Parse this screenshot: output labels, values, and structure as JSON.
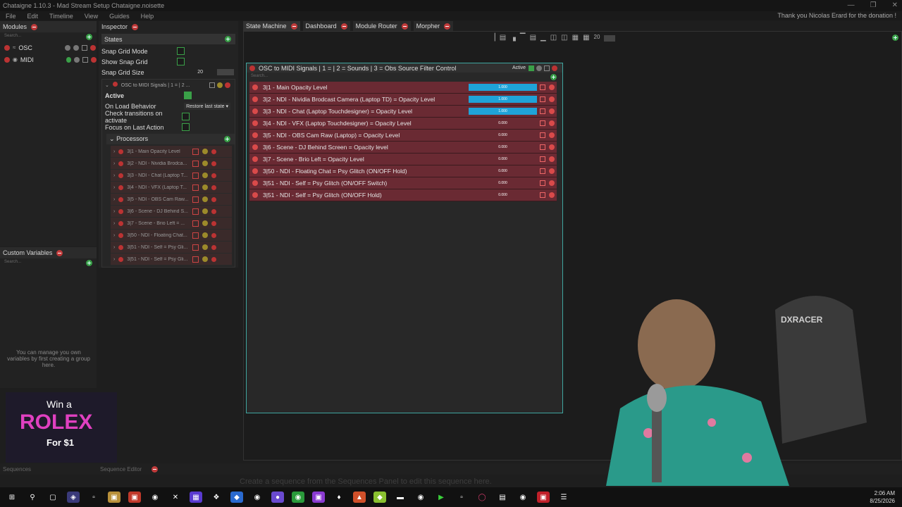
{
  "window": {
    "title": "Chataigne 1.10.3 - Mad Stream Setup Chataigne.noisette",
    "thanks": "Thank you Nicolas Erard for the donation !"
  },
  "menu": [
    "File",
    "Edit",
    "Timeline",
    "View",
    "Guides",
    "Help"
  ],
  "modules": {
    "title": "Modules",
    "search": "Search...",
    "items": [
      {
        "label": "OSC"
      },
      {
        "label": "MIDI"
      }
    ]
  },
  "custom_variables": {
    "title": "Custom Variables",
    "search": "Search...",
    "hint": "You can manage you own variables by first creating a group here."
  },
  "inspector": {
    "title": "Inspector",
    "section": "States",
    "snap_grid_mode": "Snap Grid Mode",
    "show_snap_grid": "Show Snap Grid",
    "snap_grid_size_label": "Snap Grid Size",
    "snap_grid_size": "20",
    "state_name": "OSC to MIDI Signals | 1 = | 2 ...",
    "active_label": "Active",
    "on_load_label": "On Load Behavior",
    "on_load_value": "Restore last state",
    "check_transitions": "Check transitions on activate",
    "focus_last": "Focus on Last Action",
    "processors_label": "Processors",
    "processors": [
      "3|1 - Main Opacity Level",
      "3|2 - NDI - Nividia Brodca...",
      "3|3 - NDI - Chat (Laptop T...",
      "3|4 - NDI - VFX (Laptop T...",
      "3|5 - NDI - OBS Cam Raw...",
      "3|6 - Scene - DJ Behind S...",
      "3|7 - Scene - Brio Left = ...",
      "3|50 - NDI - Floating Chat...",
      "3|51 - NDI - Self = Psy Gli...",
      "3|51 - NDI - Self = Psy Gli..."
    ]
  },
  "tabs": [
    {
      "label": "State Machine"
    },
    {
      "label": "Dashboard"
    },
    {
      "label": "Module Router"
    },
    {
      "label": "Morpher"
    }
  ],
  "toolbar": {
    "grid_size": "20"
  },
  "state": {
    "title": "OSC to MIDI Signals | 1 =  | 2 = Sounds | 3 = Obs Source Filter Control",
    "active": "Active",
    "search": "Search...",
    "actions": [
      {
        "label": "3|1 - Main Opacity Level",
        "value": "1.000",
        "fill": 1
      },
      {
        "label": "3|2 - NDI - Nividia Brodcast Camera (Laptop TD) = Opacity Level",
        "value": "1.000",
        "fill": 1
      },
      {
        "label": "3|3 - NDI - Chat (Laptop Touchdesigner) = Opacity Level",
        "value": "1.000",
        "fill": 1
      },
      {
        "label": "3|4 - NDI - VFX (Laptop Touchdesigner) = Opacity Level",
        "value": "0.000",
        "fill": 0
      },
      {
        "label": "3|5 - NDI - OBS Cam Raw (Laptop) = Opacity Level",
        "value": "0.000",
        "fill": 0
      },
      {
        "label": "3|6 - Scene - DJ Behind Screen = Opacity level",
        "value": "0.000",
        "fill": 0
      },
      {
        "label": "3|7 - Scene - Brio Left = Opacity Level",
        "value": "0.000",
        "fill": 0
      },
      {
        "label": "3|50 - NDI - Floating Chat = Psy Glitch (ON/OFF Hold)",
        "value": "0.000",
        "fill": 0
      },
      {
        "label": "3|51 - NDI - Self = Psy Glitch (ON/OFF Switch)",
        "value": "0.000",
        "fill": 0
      },
      {
        "label": "3|51 - NDI - Self = Psy Glitch (ON/OFF Hold)",
        "value": "0.000",
        "fill": 0
      }
    ]
  },
  "sequences": {
    "tab1": "Sequences",
    "tab2": "Sequence Editor",
    "hint": "Create a sequence from the Sequences Panel to edit this sequence here."
  },
  "ad": {
    "line1": "Win a",
    "line2": "ROLEX",
    "line3": "For $1"
  },
  "clock": {
    "time": "2:06 AM",
    "date": "8/25/2026"
  },
  "webcam": {
    "chair_brand": "DXRACER"
  },
  "colors": {
    "accent": "#3fa6a0",
    "action_bg": "#6a2a33",
    "fill": "#1fa3d8"
  }
}
